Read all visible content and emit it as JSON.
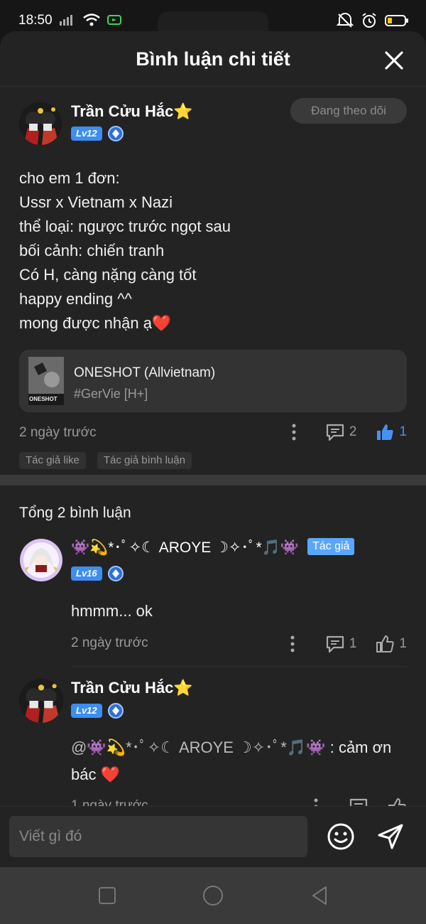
{
  "status_bar": {
    "time": "18:50"
  },
  "header": {
    "title": "Bình luận chi tiết"
  },
  "post": {
    "author": "Trần Cửu Hắc⭐",
    "level": "Lv12",
    "follow_label": "Đang theo dõi",
    "body": "cho em 1 đơn:\nUssr x Vietnam x Nazi\nthể loại: ngược trước ngọt sau\nbối cảnh: chiến tranh\nCó H, càng nặng càng tốt\nhappy ending ^^\nmong được nhận ạ❤️",
    "book": {
      "title": "ONESHOT (Allvietnam)",
      "tag": "#GerVie [H+]",
      "cover_text": "ONESHOT"
    },
    "time": "2 ngày trước",
    "comment_count": "2",
    "like_count": "1",
    "tags": [
      "Tác giả like",
      "Tác giả bình luận"
    ]
  },
  "comments_section": {
    "total_label": "Tổng 2 bình luận",
    "comments": [
      {
        "author": "👾💫*･ﾟ✧☾ AROYE ☽✧･ﾟ*🎵👾",
        "level": "Lv16",
        "author_tag": "Tác giả",
        "text": "hmmm... ok",
        "time": "2 ngày trước",
        "reply_count": "1",
        "like_count": "1"
      },
      {
        "author": "Trần Cửu Hắc⭐",
        "level": "Lv12",
        "mention": "@👾💫*･ﾟ✧☾ AROYE ☽✧･ﾟ*🎵👾",
        "text": ": cảm ơn bác ❤️",
        "time": "1 ngày trước"
      }
    ]
  },
  "composer": {
    "placeholder": "Viết gì đó"
  },
  "colors": {
    "accent": "#3d8ef0",
    "like_active": "#4a90f0",
    "sheet_bg": "#232323"
  }
}
